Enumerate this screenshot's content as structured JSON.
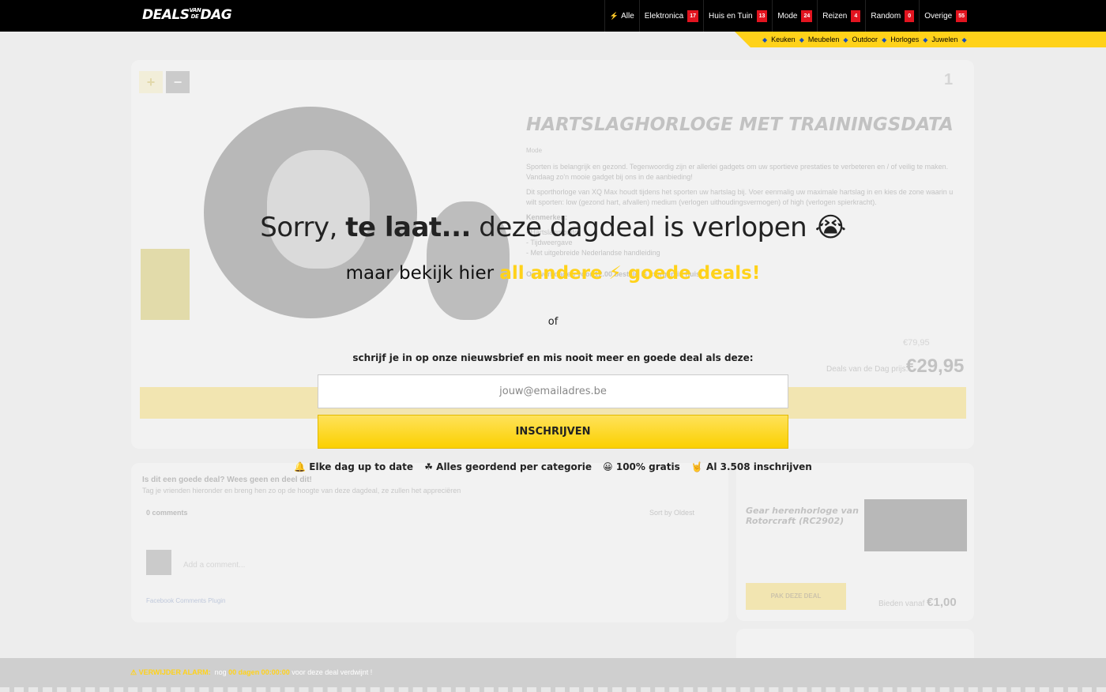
{
  "header": {
    "logo": "DEALS",
    "logo_small": "VAN DE",
    "logo_end": "DAG",
    "nav": [
      {
        "label": "Alle",
        "count": ""
      },
      {
        "label": "Elektronica",
        "count": "17"
      },
      {
        "label": "Huis en Tuin",
        "count": "13"
      },
      {
        "label": "Mode",
        "count": "24"
      },
      {
        "label": "Reizen",
        "count": "4"
      },
      {
        "label": "Random",
        "count": "0"
      },
      {
        "label": "Overige",
        "count": "55"
      }
    ],
    "subnav": [
      "Keuken",
      "Meubelen",
      "Outdoor",
      "Horloges",
      "Juwelen"
    ]
  },
  "deal": {
    "title": "HARTSLAGHORLOGE MET TRAININGSDATA",
    "category": "Mode",
    "desc1": "Sporten is belangrijk en gezond. Tegenwoordig zijn er allerlei gadgets om uw sportieve prestaties te verbeteren en / of veilig te maken. Vandaag zo'n mooie gadget bij ons in de aanbieding!",
    "desc2": "Dit sporthorloge van XQ Max houdt tijdens het sporten uw hartslag bij. Voer eenmalig uw maximale hartslag in en kies de zone waarin u wilt sporten: low (gezond hart, afvallen) medium (verlogen uithoudingsvermogen) of high (verlogen spierkracht).",
    "features_title": "Kenmerken:",
    "features": [
      "- Hartslagmonitor",
      "- Tijdweergave",
      "- Met uitgebreide Nederlandse handleiding"
    ],
    "order_note": "Op werkdagen voor 12.00 besteld is morgen in huis!",
    "votes": "1",
    "price_old": "€79,95",
    "price_label": "Deals van de Dag prijs:",
    "price_new": "€29,95"
  },
  "comments": {
    "question": "Is dit een goede deal? Wees geen en deel dit!",
    "sub": "Tag je vrienden hieronder en breng hen zo op de hoogte van deze dagdeal, ze zullen het appreciëren",
    "count": "0 comments",
    "sort": "Sort by  Oldest",
    "placeholder": "Add a comment...",
    "plugin": "Facebook Comments Plugin"
  },
  "side": {
    "title": "Gear herenhorloge van Rotorcraft (RC2902)",
    "button": "PAK DEZE DEAL",
    "price_label": "Bieden vanaf",
    "price": "€1,00"
  },
  "alarm": {
    "label": "VERWIJDER ALARM:",
    "pre": "nog",
    "time": "00 dagen 00:00:00",
    "post": "voor deze deal verdwijnt !"
  },
  "overlay": {
    "title_a": "Sorry, ",
    "title_b": "te laat...",
    "title_c": " deze dagdeal is verlopen 😭",
    "sub_a": "maar bekijk hier ",
    "sub_hl": "all andere ⚡ goede deals!",
    "or": "of",
    "newsletter": "schrijf je in op onze nieuwsbrief en mis nooit meer en goede deal als deze:",
    "email_placeholder": "jouw@emailadres.be",
    "button": "INSCHRIJVEN",
    "features": [
      "🔔 Elke dag up to date",
      "☘ Alles geordend per categorie",
      "😀 100% gratis",
      "🤘 Al 3.508 inschrijven"
    ]
  }
}
